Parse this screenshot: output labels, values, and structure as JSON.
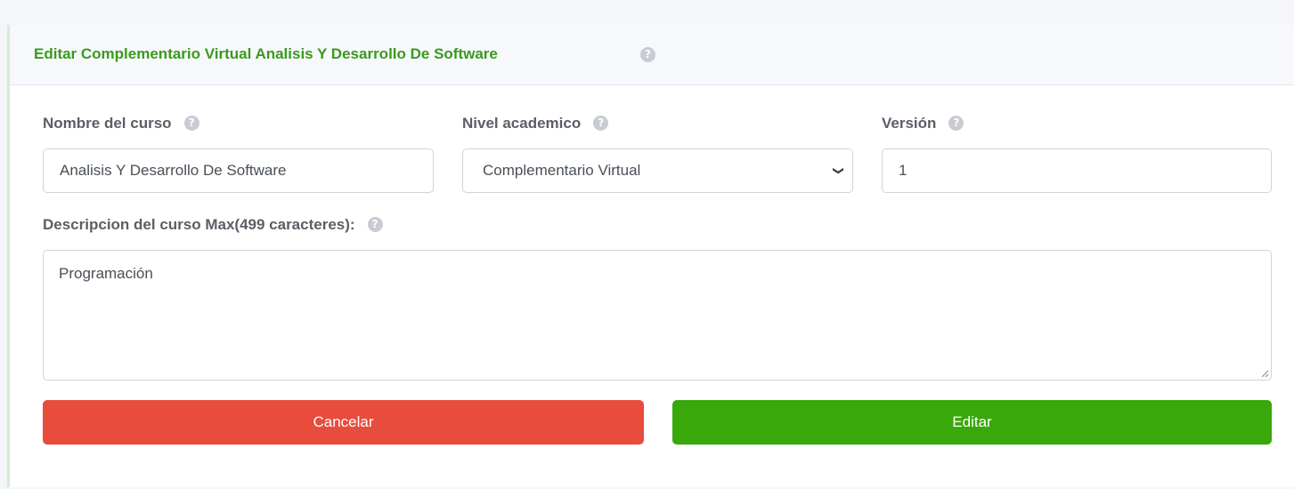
{
  "card": {
    "title": "Editar Complementario Virtual Analisis Y Desarrollo De Software",
    "help_glyph": "?"
  },
  "form": {
    "course_name": {
      "label": "Nombre del curso",
      "value": "Analisis Y Desarrollo De Software"
    },
    "academic_level": {
      "label": "Nivel academico",
      "selected": "Complementario Virtual"
    },
    "version": {
      "label": "Versión",
      "value": "1"
    },
    "description": {
      "label": "Descripcion del curso Max(499 caracteres):",
      "value": "Programación"
    }
  },
  "actions": {
    "cancel_label": "Cancelar",
    "edit_label": "Editar"
  },
  "colors": {
    "title_green": "#3a9a1d",
    "cancel_red": "#e74c3c",
    "edit_green": "#38a80a"
  }
}
